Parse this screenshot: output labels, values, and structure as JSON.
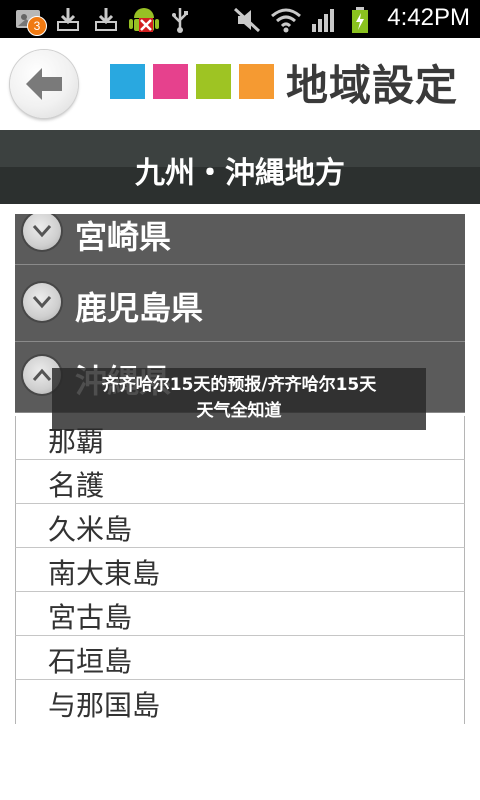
{
  "status_bar": {
    "notification_count": "3",
    "time": "4:42PM"
  },
  "header": {
    "title": "地域設定",
    "colors": [
      "#29a8e0",
      "#e6418d",
      "#9ec423",
      "#f59a32"
    ]
  },
  "region": {
    "title": "九州・沖縄地方"
  },
  "prefectures": [
    {
      "label": "宮崎県",
      "expanded": false
    },
    {
      "label": "鹿児島県",
      "expanded": false
    },
    {
      "label": "沖縄県",
      "expanded": true
    }
  ],
  "cities": [
    "那覇",
    "名護",
    "久米島",
    "南大東島",
    "宮古島",
    "石垣島",
    "与那国島"
  ],
  "overlay": {
    "line1": "齐齐哈尔15天的预报/齐齐哈尔15天",
    "line2": "天气全知道"
  }
}
